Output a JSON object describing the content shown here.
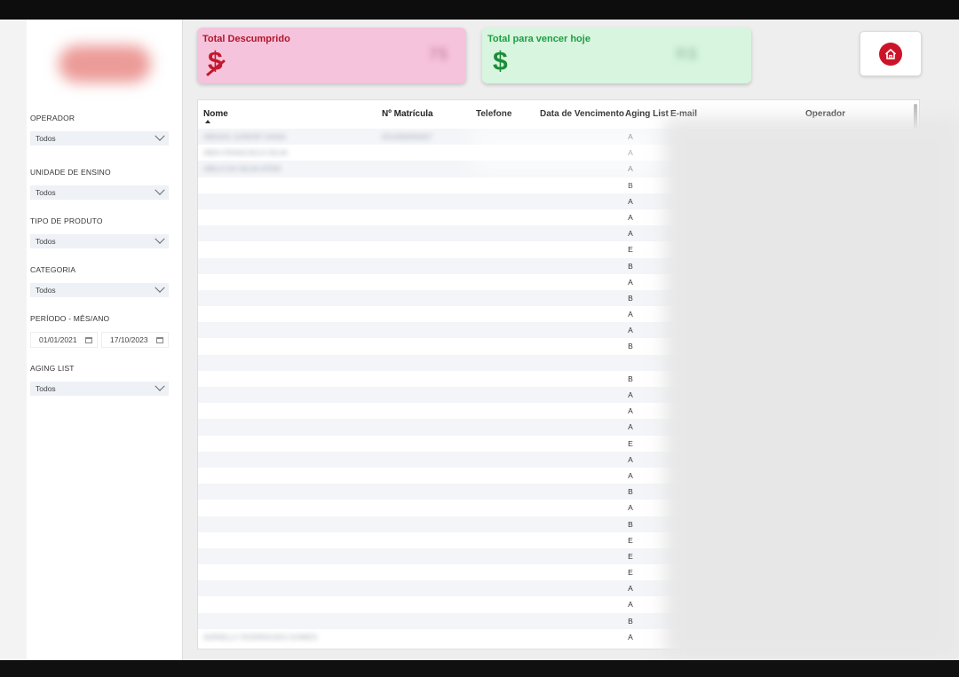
{
  "sidebar": {
    "filters": [
      {
        "label": "OPERADOR",
        "value": "Todos"
      },
      {
        "label": "UNIDADE DE ENSINO",
        "value": "Todos"
      },
      {
        "label": "TIPO DE PRODUTO",
        "value": "Todos"
      },
      {
        "label": "CATEGORIA",
        "value": "Todos"
      }
    ],
    "period": {
      "label": "PERÍODO - MÊS/ANO",
      "start": "01/01/2021",
      "end": "17/10/2023"
    },
    "aging": {
      "label": "AGING LIST",
      "value": "Todos"
    }
  },
  "cards": {
    "descumprido": {
      "title": "Total Descumprido",
      "icon": "$",
      "value": "75"
    },
    "vencer": {
      "title": "Total para vencer hoje",
      "icon": "$",
      "value": "R$"
    }
  },
  "home_button": {
    "icon": "home-icon"
  },
  "table": {
    "headers": [
      "Nome",
      "Nº Matrícula",
      "Telefone",
      "Data de Vencimento",
      "Aging List",
      "E-mail",
      "Operador"
    ],
    "rows": [
      {
        "nome": "ABDIAS JUNIOR VIANA",
        "matricula": "051090000007",
        "aging": "A"
      },
      {
        "nome": "ABIA FRANCISCA SILVA",
        "matricula": "",
        "aging": "A"
      },
      {
        "nome": "ABILA DA SILVA ATEM",
        "matricula": "",
        "aging": "A"
      },
      {
        "nome": "",
        "matricula": "",
        "aging": "B"
      },
      {
        "nome": "",
        "matricula": "",
        "aging": "A"
      },
      {
        "nome": "",
        "matricula": "",
        "aging": "A"
      },
      {
        "nome": "",
        "matricula": "",
        "aging": "A"
      },
      {
        "nome": "",
        "matricula": "",
        "aging": "E"
      },
      {
        "nome": "",
        "matricula": "",
        "aging": "B"
      },
      {
        "nome": "",
        "matricula": "",
        "aging": "A"
      },
      {
        "nome": "",
        "matricula": "",
        "aging": "B"
      },
      {
        "nome": "",
        "matricula": "",
        "aging": "A"
      },
      {
        "nome": "",
        "matricula": "",
        "aging": "A"
      },
      {
        "nome": "",
        "matricula": "",
        "aging": "B"
      },
      {
        "nome": "",
        "matricula": "",
        "aging": ""
      },
      {
        "nome": "",
        "matricula": "",
        "aging": "B"
      },
      {
        "nome": "",
        "matricula": "",
        "aging": "A"
      },
      {
        "nome": "",
        "matricula": "",
        "aging": "A"
      },
      {
        "nome": "",
        "matricula": "",
        "aging": "A"
      },
      {
        "nome": "",
        "matricula": "",
        "aging": "E"
      },
      {
        "nome": "",
        "matricula": "",
        "aging": "A"
      },
      {
        "nome": "",
        "matricula": "",
        "aging": "A"
      },
      {
        "nome": "",
        "matricula": "",
        "aging": "B"
      },
      {
        "nome": "",
        "matricula": "",
        "aging": "A"
      },
      {
        "nome": "",
        "matricula": "",
        "aging": "B"
      },
      {
        "nome": "",
        "matricula": "",
        "aging": "E"
      },
      {
        "nome": "",
        "matricula": "",
        "aging": "E"
      },
      {
        "nome": "",
        "matricula": "",
        "aging": "E"
      },
      {
        "nome": "",
        "matricula": "",
        "aging": "A"
      },
      {
        "nome": "",
        "matricula": "",
        "aging": "A"
      },
      {
        "nome": "",
        "matricula": "",
        "aging": "B"
      },
      {
        "nome": "ADRIELLY RODRIGUES GOMES",
        "matricula": "",
        "aging": "A"
      }
    ]
  }
}
